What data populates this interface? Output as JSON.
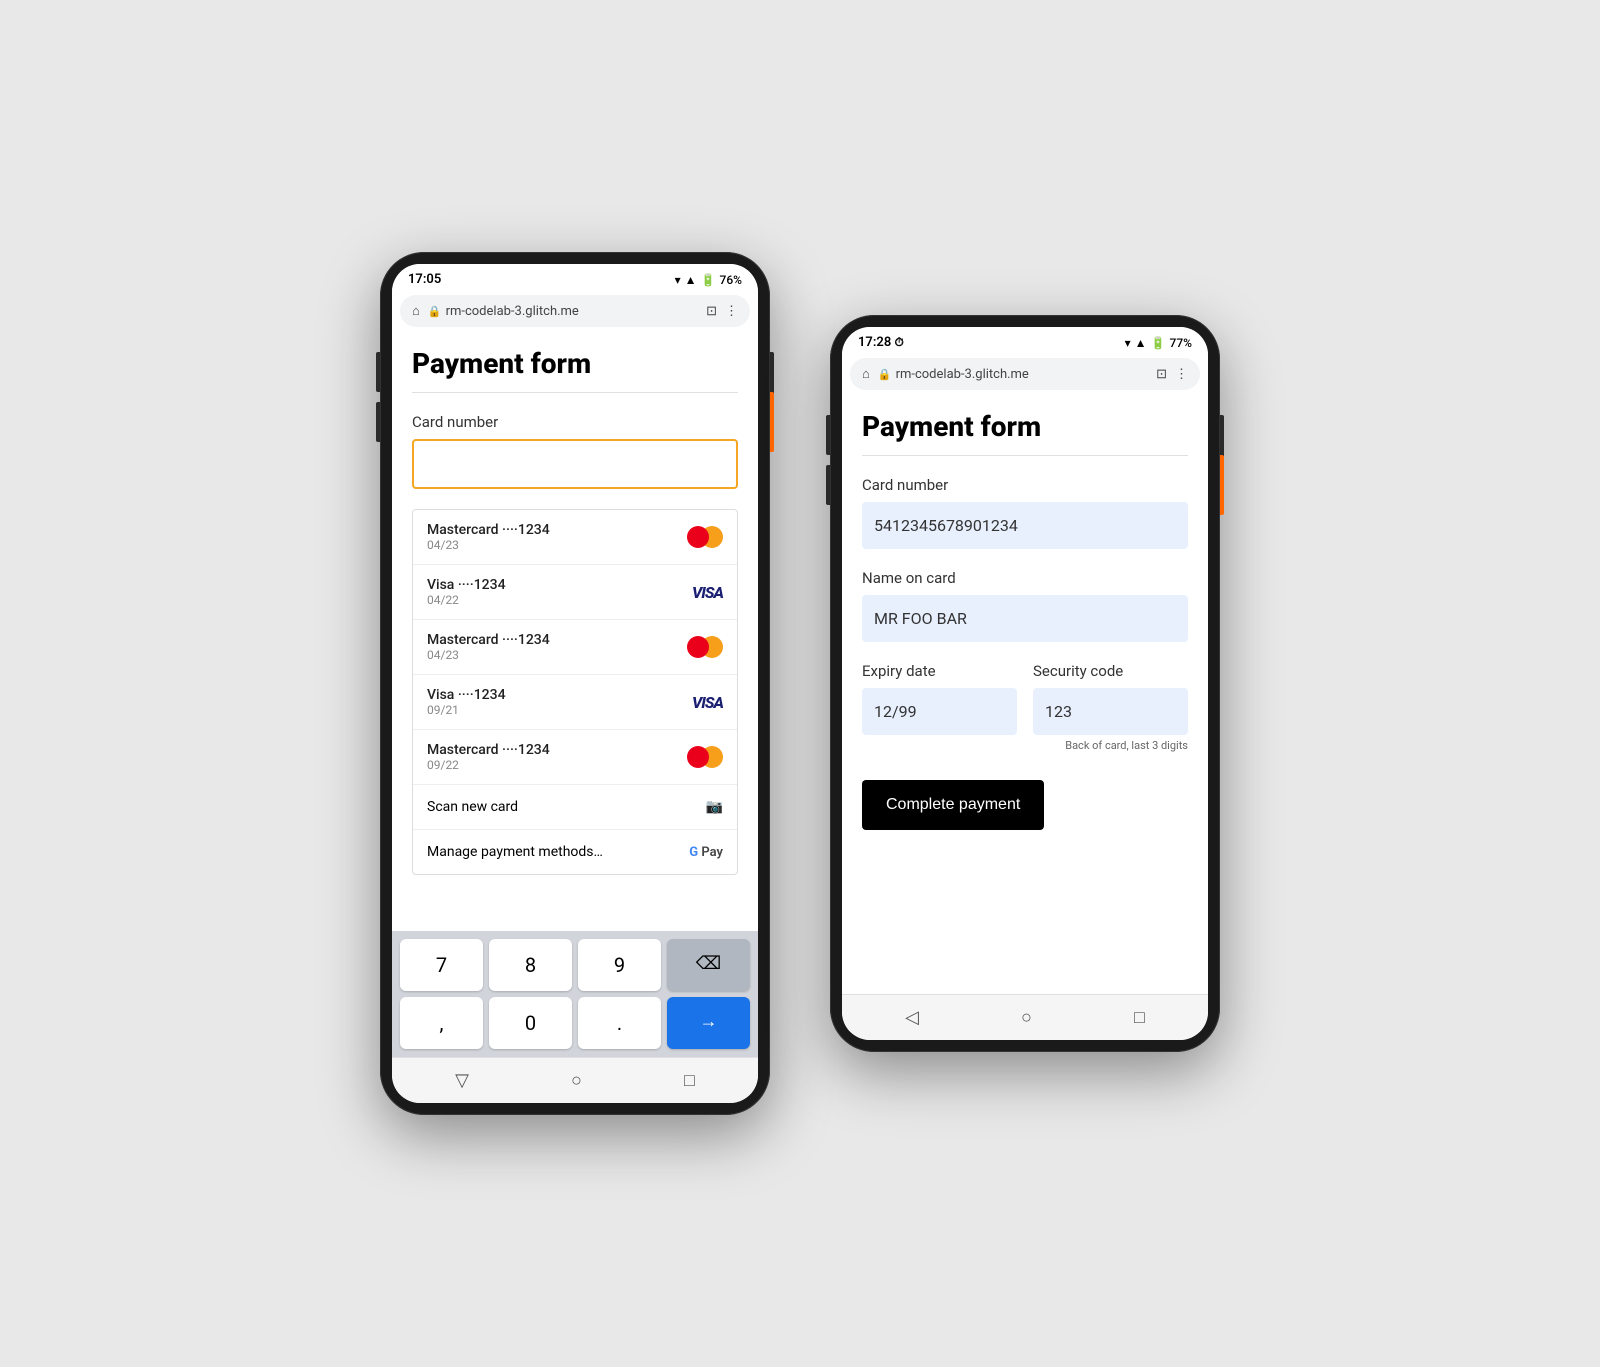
{
  "phone1": {
    "status": {
      "time": "17:05",
      "battery": "76%",
      "signal": "▲",
      "wifi": "▼"
    },
    "browser": {
      "url": "rm-codelab-3.glitch.me"
    },
    "page": {
      "title": "Payment form",
      "card_number_label": "Card number",
      "card_input_placeholder": ""
    },
    "autocomplete": {
      "items": [
        {
          "name": "Mastercard ····1234",
          "exp": "04/23",
          "type": "mastercard"
        },
        {
          "name": "Visa ····1234",
          "exp": "04/22",
          "type": "visa"
        },
        {
          "name": "Mastercard ····1234",
          "exp": "04/23",
          "type": "mastercard"
        },
        {
          "name": "Visa ····1234",
          "exp": "09/21",
          "type": "visa"
        },
        {
          "name": "Mastercard ····1234",
          "exp": "09/22",
          "type": "mastercard"
        }
      ],
      "scan_label": "Scan new card",
      "manage_label": "Manage payment methods…"
    },
    "keyboard": {
      "keys": [
        "7",
        "8",
        "9",
        "⌫",
        ",",
        "0",
        ".",
        "→"
      ]
    }
  },
  "phone2": {
    "status": {
      "time": "17:28",
      "battery": "77%"
    },
    "browser": {
      "url": "rm-codelab-3.glitch.me"
    },
    "page": {
      "title": "Payment form",
      "card_number_label": "Card number",
      "card_number_value": "5412345678901234",
      "name_label": "Name on card",
      "name_value": "MR FOO BAR",
      "expiry_label": "Expiry date",
      "expiry_value": "12/99",
      "security_label": "Security code",
      "security_value": "123",
      "security_hint": "Back of card, last 3 digits",
      "complete_btn": "Complete payment"
    }
  }
}
